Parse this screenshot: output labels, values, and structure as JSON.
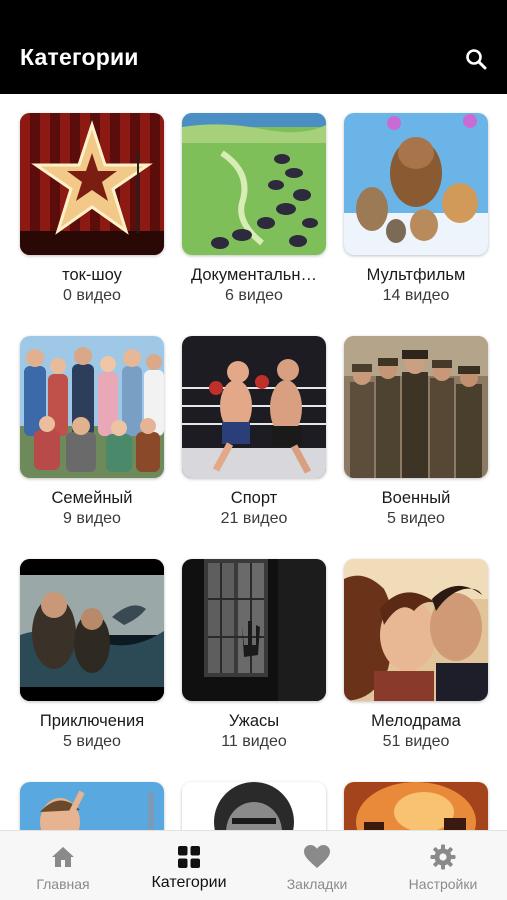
{
  "header": {
    "title": "Категории",
    "search_icon": "search-icon"
  },
  "categories": [
    {
      "name": "ток-шоу",
      "count": "0 видео",
      "image": "star-stage"
    },
    {
      "name": "Документальн…",
      "count": "6 видео",
      "image": "nature-herd"
    },
    {
      "name": "Мультфильм",
      "count": "14 видео",
      "image": "cartoon"
    },
    {
      "name": "Семейный",
      "count": "9 видео",
      "image": "family-group"
    },
    {
      "name": "Спорт",
      "count": "21 видео",
      "image": "boxing-ring"
    },
    {
      "name": "Военный",
      "count": "5 видео",
      "image": "soldiers"
    },
    {
      "name": "Приключения",
      "count": "5 видео",
      "image": "sea-whale"
    },
    {
      "name": "Ужасы",
      "count": "11 видео",
      "image": "dark-window"
    },
    {
      "name": "Мелодрама",
      "count": "51 видео",
      "image": "romance"
    }
  ],
  "tabbar": {
    "items": [
      {
        "label": "Главная",
        "icon": "home-icon",
        "active": false
      },
      {
        "label": "Категории",
        "icon": "grid-icon",
        "active": true
      },
      {
        "label": "Закладки",
        "icon": "heart-icon",
        "active": false
      },
      {
        "label": "Настройки",
        "icon": "gear-icon",
        "active": false
      }
    ]
  },
  "colors": {
    "header_bg": "#000000",
    "header_text": "#ffffff",
    "tab_active": "#111111",
    "tab_inactive": "#8a8a8a"
  }
}
